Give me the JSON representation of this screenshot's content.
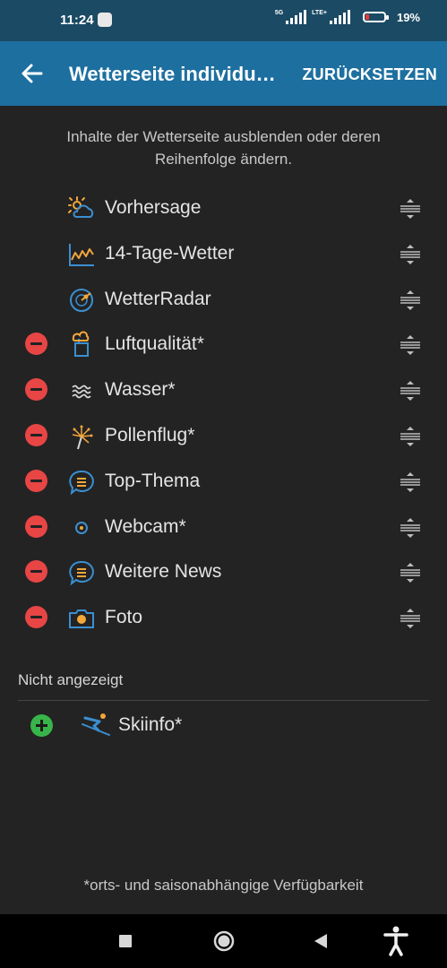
{
  "status": {
    "time": "11:24",
    "net1": "5G",
    "net2": "LTE+",
    "battery": "19%"
  },
  "app_bar": {
    "title": "Wetterseite individu…",
    "reset_label": "ZURÜCKSETZEN"
  },
  "intro": "Inhalte der Wetterseite ausblenden oder deren Reihenfolge ändern.",
  "shown_items": [
    {
      "label": "Vorhersage",
      "removable": false,
      "icon": "sun-cloud-icon"
    },
    {
      "label": "14-Tage-Wetter",
      "removable": false,
      "icon": "chart-icon"
    },
    {
      "label": "WetterRadar",
      "removable": false,
      "icon": "radar-icon"
    },
    {
      "label": "Luftqualität*",
      "removable": true,
      "icon": "factory-icon"
    },
    {
      "label": "Wasser*",
      "removable": true,
      "icon": "water-icon"
    },
    {
      "label": "Pollenflug*",
      "removable": true,
      "icon": "pollen-icon"
    },
    {
      "label": "Top-Thema",
      "removable": true,
      "icon": "chat-icon"
    },
    {
      "label": "Webcam*",
      "removable": true,
      "icon": "webcam-icon"
    },
    {
      "label": "Weitere News",
      "removable": true,
      "icon": "chat-icon"
    },
    {
      "label": "Foto",
      "removable": true,
      "icon": "camera-icon"
    }
  ],
  "hidden_section": {
    "title": "Nicht angezeigt",
    "items": [
      {
        "label": "Skiinfo*",
        "icon": "skier-icon"
      }
    ]
  },
  "footnote": "*orts- und saisonabhängige Verfügbarkeit",
  "colors": {
    "app_bar": "#1d6fa0",
    "status_bar": "#1b4a64",
    "background": "#232323",
    "remove": "#e84545",
    "add": "#38b54a",
    "icon_orange": "#f2a73b",
    "icon_blue": "#3b8fd1"
  }
}
